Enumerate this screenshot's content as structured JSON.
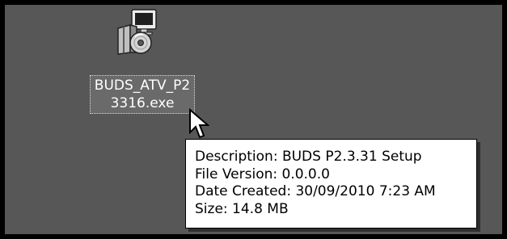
{
  "desktop": {
    "background_color": "#575757",
    "file": {
      "icon": "installer-package-icon",
      "label_line1": "BUDS_ATV_P2",
      "label_line2": "3316.exe"
    },
    "cursor_icon": "arrow-cursor-icon"
  },
  "tooltip": {
    "description": "Description: BUDS P2.3.31 Setup",
    "file_version": "File Version: 0.0.0.0",
    "date_created": "Date Created: 30/09/2010 7:23 AM",
    "size": "Size: 14.8 MB"
  }
}
